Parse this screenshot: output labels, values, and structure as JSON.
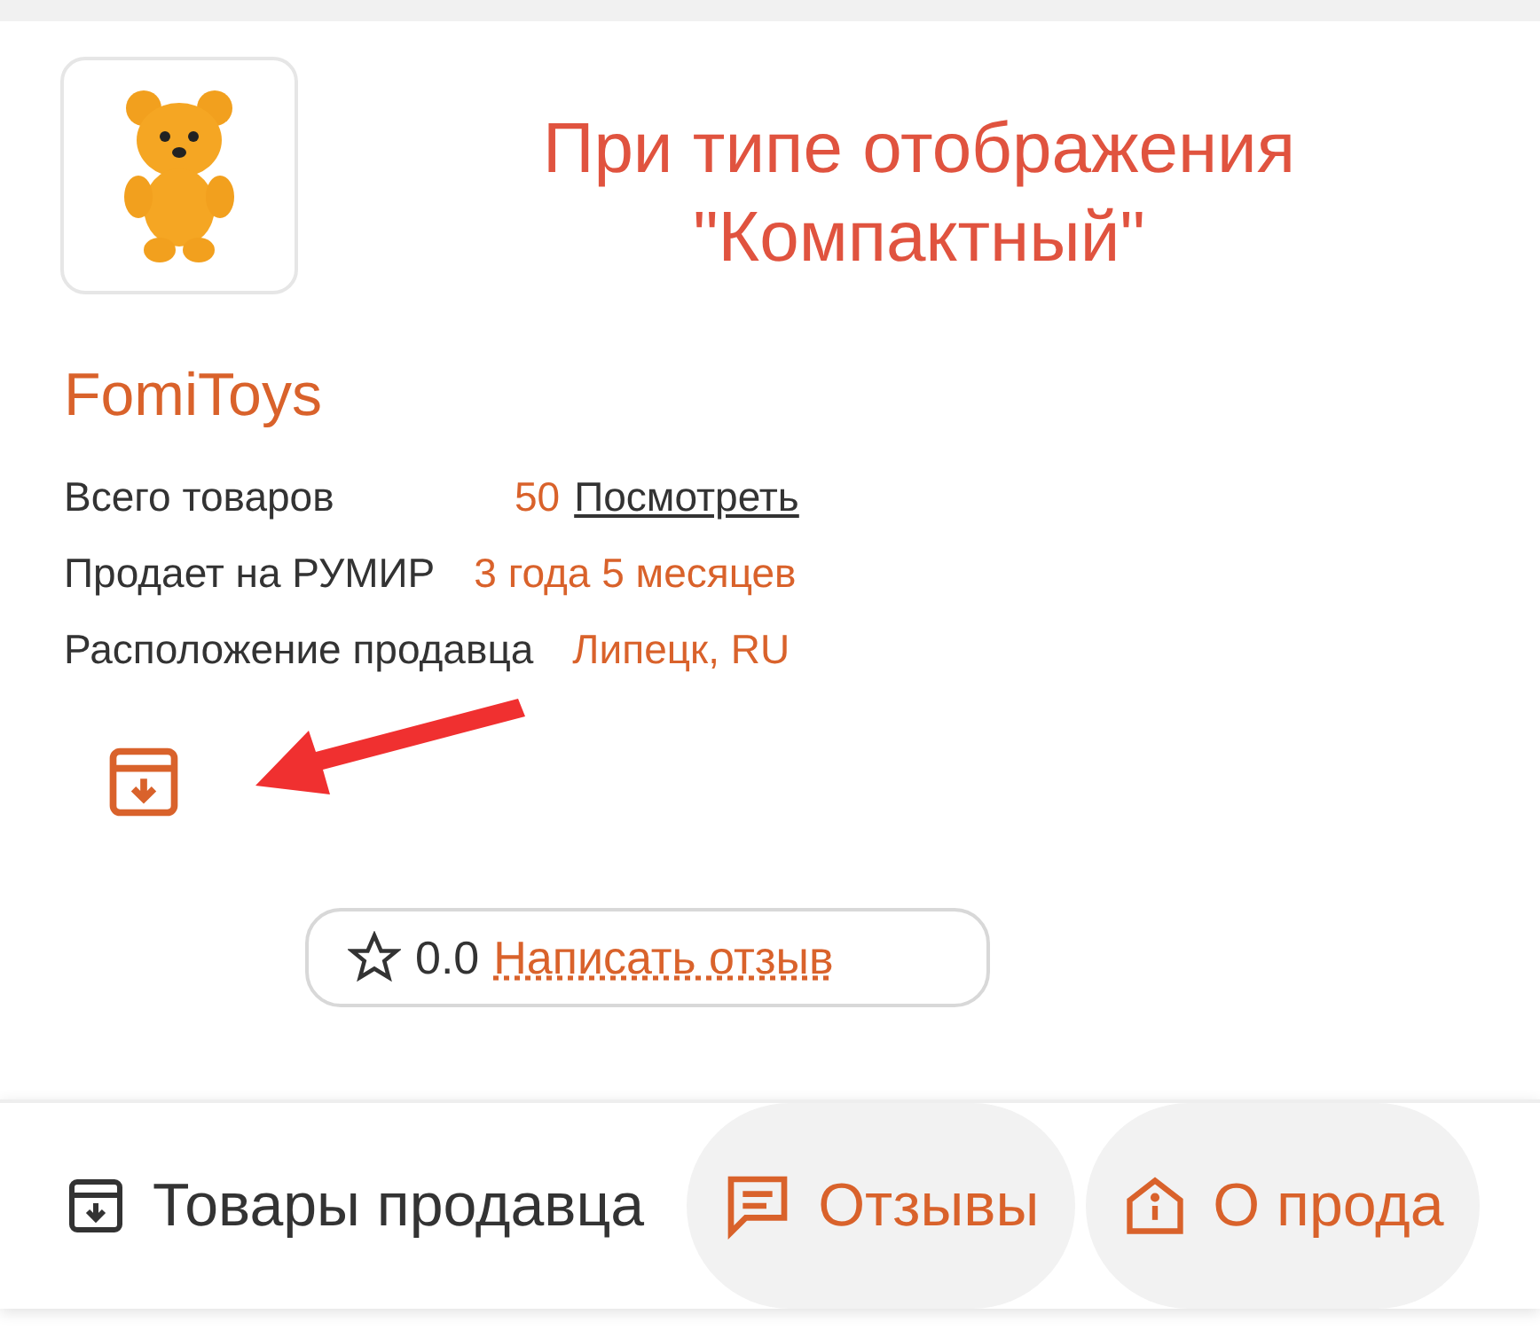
{
  "annotation": {
    "lines": [
      "При типе отображения",
      "\"Компактный\""
    ]
  },
  "seller": {
    "name": "FomiToys"
  },
  "info": [
    {
      "label": "Всего товаров",
      "value": "50",
      "link": "Посмотреть"
    },
    {
      "label": "Продает на РУМИР",
      "value": "3 года 5 месяцев"
    },
    {
      "label": "Расположение продавца",
      "value": "Липецк, RU"
    }
  ],
  "rating": {
    "score": "0.0",
    "link": "Написать отзыв"
  },
  "tabs": [
    {
      "kind": "products",
      "label": "Товары продавца",
      "selected": true
    },
    {
      "kind": "reviews",
      "label": "Отзывы",
      "selected": false
    },
    {
      "kind": "about",
      "label": "О прода",
      "selected": false
    }
  ]
}
